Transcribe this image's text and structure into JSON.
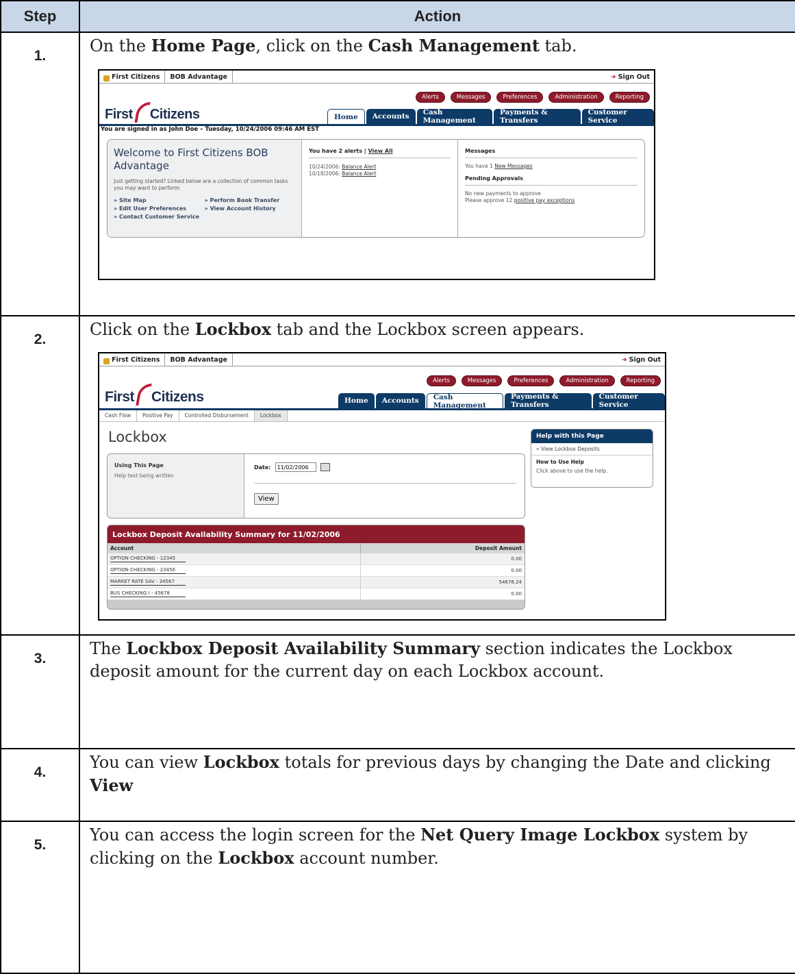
{
  "header": {
    "step": "Step",
    "action": "Action"
  },
  "steps": [
    {
      "num": "1.",
      "pre": "On the ",
      "b1": "Home Page",
      "mid": ", click on the ",
      "b2": "Cash Management",
      "post": " tab."
    },
    {
      "num": "2.",
      "pre": "Click on the ",
      "b1": "Lockbox",
      "post": " tab and the Lockbox screen appears."
    },
    {
      "num": "3.",
      "pre": "The ",
      "b1": "Lockbox Deposit Availability Summary",
      "post": " section indicates the Lockbox deposit amount for the current day on each Lockbox account."
    },
    {
      "num": "4.",
      "pre": "You can view ",
      "b1": "Lockbox",
      "mid": " totals for previous days by changing the Date and clicking ",
      "b2": "View",
      "post": ""
    },
    {
      "num": "5.",
      "pre": "You can access the login screen for the ",
      "b1": "Net Query Image Lockbox",
      "mid": " system by clicking on the ",
      "b2": "Lockbox",
      "post": " account number."
    }
  ],
  "app": {
    "tab_first_citizens": "First Citizens",
    "tab_bob": "BOB Advantage",
    "sign_out": "Sign Out",
    "logo_first": "First",
    "logo_citizens": "Citizens",
    "pills": [
      "Alerts",
      "Messages",
      "Preferences",
      "Administration",
      "Reporting"
    ],
    "nav": [
      "Home",
      "Accounts",
      "Cash Management",
      "Payments & Transfers",
      "Customer Service"
    ]
  },
  "shot1": {
    "signed_in": "You are signed in as John Doe – Tuesday, 10/24/2006 09:46 AM EST",
    "welcome_title": "Welcome to First Citizens BOB Advantage",
    "welcome_text": "Just getting started? Linked below are a collection of common tasks you may want to perform:",
    "quick_links": [
      "» Site Map",
      "» Perform Book Transfer",
      "» Edit User Preferences",
      "» View Account History",
      "» Contact Customer Service"
    ],
    "alerts_head": "You have 2 alerts | ",
    "alerts_view_all": "View All",
    "alerts": [
      {
        "date": "10/24/2006: ",
        "link": "Balance Alert"
      },
      {
        "date": "10/18/2006: ",
        "link": "Balance Alert"
      }
    ],
    "messages_head": "Messages",
    "messages_text": "You have 1 ",
    "messages_link": "New Messages",
    "pending_head": "Pending Approvals",
    "pending_line1": "No new payments to approve",
    "pending_line2": "Please approve 12 ",
    "pending_link": "positive pay exceptions"
  },
  "shot2": {
    "subnav": [
      "Cash Flow",
      "Positive Pay",
      "Controlled Disbursement",
      "Lockbox"
    ],
    "page_title": "Lockbox",
    "using_head": "Using This Page",
    "using_text": "Help text being written",
    "date_label": "Date:",
    "date_value": "11/02/2006",
    "view_button": "View",
    "help_head": "Help with this Page",
    "help_link": "» View Lockbox Deposits",
    "how_head": "How to Use Help",
    "how_text": "Click above to use the help.",
    "summary_title": "Lockbox Deposit Availability Summary for 11/02/2006",
    "col_account": "Account",
    "col_amount": "Deposit Amount",
    "rows": [
      {
        "account": "OPTION CHECKING - 12345",
        "amount": "0.00"
      },
      {
        "account": "OPTION CHECKING - 23456",
        "amount": "0.00"
      },
      {
        "account": "MARKET RATE SAV - 34567",
        "amount": "54678.24"
      },
      {
        "account": "BUS CHECKING I - 45678",
        "amount": "0.00"
      }
    ]
  }
}
